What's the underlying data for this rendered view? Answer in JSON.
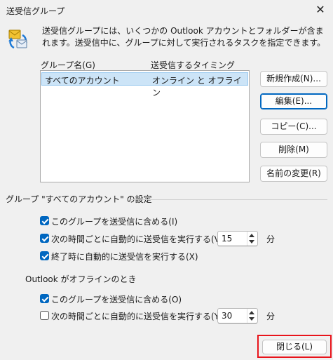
{
  "window": {
    "title": "送受信グループ",
    "close_glyph": "✕"
  },
  "description": "送受信グループには、いくつかの Outlook アカウントとフォルダーが含まれます。送受信中に、グループに対して実行されるタスクを指定できます。",
  "list": {
    "columns": [
      "グループ名(G)",
      "送受信するタイミング"
    ],
    "rows": [
      {
        "name": "すべてのアカウント",
        "timing": "オンライン と オフライン",
        "selected": true
      }
    ]
  },
  "buttons": {
    "new": "新規作成(N)...",
    "edit": "編集(E)...",
    "copy": "コピー(C)...",
    "delete": "削除(M)",
    "rename": "名前の変更(R)"
  },
  "settings": {
    "title": "グループ \"すべてのアカウント\" の設定",
    "online": {
      "include": {
        "label": "このグループを送受信に含める(I)",
        "checked": true
      },
      "auto": {
        "label": "次の時間ごとに自動的に送受信を実行する(V)",
        "checked": true,
        "minutes": "15"
      },
      "on_exit": {
        "label": "終了時に自動的に送受信を実行する(X)",
        "checked": true
      }
    },
    "offline_title": "Outlook がオフラインのとき",
    "offline": {
      "include": {
        "label": "このグループを送受信に含める(O)",
        "checked": true
      },
      "auto": {
        "label": "次の時間ごとに自動的に送受信を実行する(Y)",
        "checked": false,
        "minutes": "30"
      }
    },
    "unit": "分"
  },
  "footer": {
    "close": "閉じる(L)"
  },
  "colors": {
    "accent": "#0067c0",
    "highlight": "#e8141b",
    "selection": "#cce4f7"
  }
}
